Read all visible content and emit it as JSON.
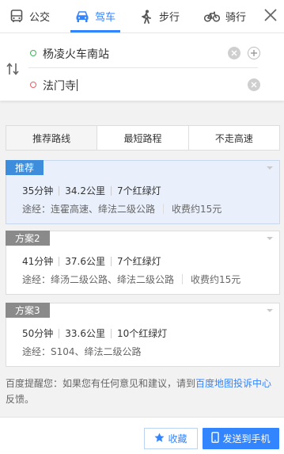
{
  "modes": [
    {
      "label": "公交",
      "icon": "bus-icon"
    },
    {
      "label": "驾车",
      "icon": "car-icon"
    },
    {
      "label": "步行",
      "icon": "walk-icon"
    },
    {
      "label": "骑行",
      "icon": "bike-icon"
    }
  ],
  "active_mode": "驾车",
  "route": {
    "start": "杨凌火车南站",
    "end": "法门寺"
  },
  "tabs": [
    "推荐路线",
    "最短路程",
    "不走高速"
  ],
  "active_tab": "推荐路线",
  "plans": [
    {
      "label": "推荐",
      "time": "35分钟",
      "distance": "34.2公里",
      "lights": "7个红绿灯",
      "via": "途经：连霍高速、绛法二级公路",
      "toll": "收费约15元"
    },
    {
      "label": "方案2",
      "time": "41分钟",
      "distance": "37.6公里",
      "lights": "7个红绿灯",
      "via": "途经：绛汤二级公路、绛法二级公路",
      "toll": "收费约15元"
    },
    {
      "label": "方案3",
      "time": "50分钟",
      "distance": "33.6公里",
      "lights": "10个红绿灯",
      "via": "途经：S104、绛法二级公路"
    }
  ],
  "tip": {
    "text": "百度提醒您：如果您有任何意见和建议，请到",
    "link": "百度地图投诉中心",
    "suffix": "反馈。"
  },
  "actions": {
    "favorite": "收藏",
    "send_to_phone": "发送到手机"
  },
  "colors": {
    "accent": "#3385ff",
    "selected_bg": "#e9f0fb",
    "label_blue": "#3d8ddc",
    "label_gray": "#8a8a8a"
  }
}
